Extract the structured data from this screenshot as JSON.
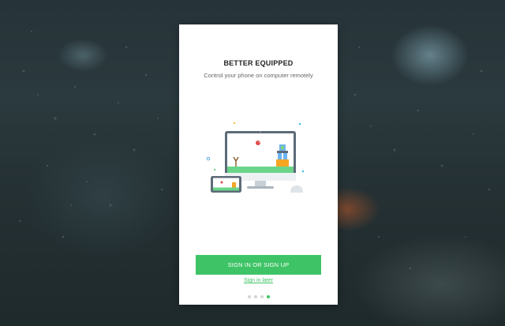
{
  "onboarding": {
    "title": "BETTER EQUIPPED",
    "subtitle": "Control your phone on computer remotely",
    "primary_button": "SIGN IN OR SIGN UP",
    "secondary_link": "Sign in later",
    "pagination": {
      "total": 4,
      "active_index": 3
    }
  },
  "colors": {
    "accent": "#3ec466",
    "card_background": "#ffffff",
    "title_text": "#222222",
    "subtitle_text": "#666666",
    "inactive_dot": "#d4d4d4"
  },
  "icons": {
    "illustration": "desktop-and-phone-illustration",
    "mouse": "mouse-icon"
  }
}
